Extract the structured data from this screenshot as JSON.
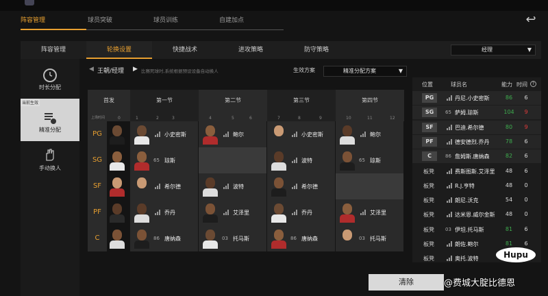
{
  "main_tabs": [
    "阵容管理",
    "球员突破",
    "球员训练",
    "自建加点"
  ],
  "sub_tabs": [
    "阵容管理",
    "轮换设置",
    "快捷战术",
    "进攻策略",
    "防守策略"
  ],
  "role_select": "经理",
  "side_nav": {
    "current_tag": "当前生效",
    "items": [
      "时长分配",
      "精准分配",
      "手动换人"
    ]
  },
  "header": {
    "name": "王朝/经理",
    "hint": "比赛死球时,系统根据预设设备自动换人",
    "scheme_label": "生效方案",
    "scheme_value": "精准分配方案"
  },
  "grid": {
    "starter_label": "首发",
    "minute_label": "上场时间",
    "quarters": [
      "第一节",
      "第二节",
      "第三节",
      "第四节"
    ],
    "minutes": [
      "0",
      "1",
      "2",
      "3",
      "4",
      "5",
      "6",
      "7",
      "8",
      "9",
      "10",
      "11",
      "12"
    ],
    "rows": [
      {
        "pos": "PG",
        "cells": [
          {
            "name": "小史密斯",
            "num": ""
          },
          {
            "name": "鲍尔",
            "num": ""
          },
          {
            "name": "小史密斯",
            "num": ""
          },
          {
            "name": "鲍尔",
            "num": ""
          }
        ]
      },
      {
        "pos": "SG",
        "cells": [
          {
            "name": "琼斯",
            "num": "65"
          },
          null,
          {
            "name": "波特",
            "num": ""
          },
          {
            "name": "琼斯",
            "num": "65"
          }
        ]
      },
      {
        "pos": "SF",
        "cells": [
          {
            "name": "希尔德",
            "num": ""
          },
          {
            "name": "波特",
            "num": ""
          },
          {
            "name": "希尔德",
            "num": ""
          },
          null
        ]
      },
      {
        "pos": "PF",
        "cells": [
          {
            "name": "乔丹",
            "num": ""
          },
          {
            "name": "艾泽里",
            "num": ""
          },
          {
            "name": "乔丹",
            "num": ""
          },
          {
            "name": "艾泽里",
            "num": ""
          }
        ]
      },
      {
        "pos": "C",
        "cells": [
          {
            "name": "唐纳森",
            "num": "86"
          },
          {
            "name": "托马斯",
            "num": "03"
          },
          {
            "name": "唐纳森",
            "num": "86"
          },
          {
            "name": "托马斯",
            "num": "03"
          }
        ]
      }
    ]
  },
  "roster": {
    "headers": {
      "pos": "位置",
      "name": "球员名",
      "rating": "能力",
      "time": "时间"
    },
    "players": [
      {
        "pos": "PG",
        "num": "",
        "name": "丹尼.小史密斯",
        "rating": "86",
        "rating_color": "#3fae4f",
        "time": "6",
        "time_color": "#dddddd",
        "starter": true
      },
      {
        "pos": "SG",
        "num": "65",
        "name": "萨姆.琼斯",
        "rating": "104",
        "rating_color": "#3fae4f",
        "time": "9",
        "time_color": "#e23b3b",
        "starter": true
      },
      {
        "pos": "SF",
        "num": "",
        "name": "巴迪.希尔德",
        "rating": "80",
        "rating_color": "#3fae4f",
        "time": "9",
        "time_color": "#e23b3b",
        "starter": true
      },
      {
        "pos": "PF",
        "num": "",
        "name": "德安德烈.乔丹",
        "rating": "78",
        "rating_color": "#3fae4f",
        "time": "6",
        "time_color": "#dddddd",
        "starter": true
      },
      {
        "pos": "C",
        "num": "86",
        "name": "詹姆斯.唐纳森",
        "rating": "82",
        "rating_color": "#3fae4f",
        "time": "6",
        "time_color": "#dddddd",
        "starter": true
      },
      {
        "pos": "板凳",
        "num": "",
        "name": "费斯图斯.艾泽里",
        "rating": "48",
        "rating_color": "#dddddd",
        "time": "6",
        "time_color": "#dddddd",
        "starter": false
      },
      {
        "pos": "板凳",
        "num": "",
        "name": "R.J.亨特",
        "rating": "48",
        "rating_color": "#dddddd",
        "time": "0",
        "time_color": "#dddddd",
        "starter": false
      },
      {
        "pos": "板凳",
        "num": "",
        "name": "朗尼.沃克",
        "rating": "54",
        "rating_color": "#dddddd",
        "time": "0",
        "time_color": "#dddddd",
        "starter": false
      },
      {
        "pos": "板凳",
        "num": "",
        "name": "达米恩.威尔金斯",
        "rating": "48",
        "rating_color": "#dddddd",
        "time": "0",
        "time_color": "#dddddd",
        "starter": false
      },
      {
        "pos": "板凳",
        "num": "03",
        "name": "伊坦.托马斯",
        "rating": "81",
        "rating_color": "#3fae4f",
        "time": "6",
        "time_color": "#dddddd",
        "starter": false
      },
      {
        "pos": "板凳",
        "num": "",
        "name": "朗佐.鲍尔",
        "rating": "81",
        "rating_color": "#3fae4f",
        "time": "6",
        "time_color": "#dddddd",
        "starter": false
      },
      {
        "pos": "板凳",
        "num": "",
        "name": "奥托.波特",
        "rating": "",
        "rating_color": "#dddddd",
        "time": "",
        "time_color": "#dddddd",
        "starter": false
      }
    ]
  },
  "clear_button": "清除",
  "watermark": "@费城大腚比德恩",
  "logo": "Hupu",
  "colors": {
    "accent": "#e9a030",
    "good": "#3fae4f",
    "bad": "#e23b3b"
  }
}
